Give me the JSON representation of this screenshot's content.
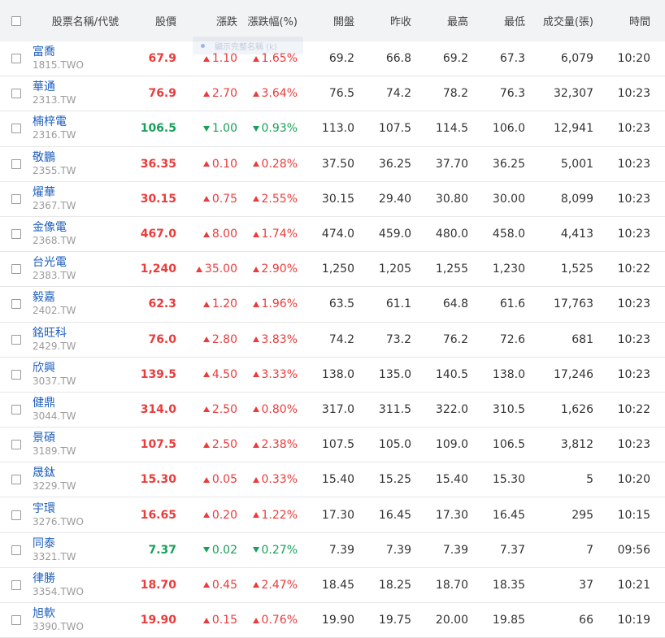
{
  "header": {
    "name_code": "股票名稱/代號",
    "price": "股價",
    "change": "漲跌",
    "change_pct": "漲跌幅(%)",
    "open": "開盤",
    "prev_close": "昨收",
    "high": "最高",
    "low": "最低",
    "volume": "成交量(張)",
    "time": "時間"
  },
  "tooltip": {
    "text": "顯示完整名稱 (k)"
  },
  "colors": {
    "up": "#eb3b3b",
    "down": "#18a058",
    "link": "#1f5fbf",
    "header_bg": "#f2f3f5"
  },
  "rows": [
    {
      "name": "富喬",
      "code": "1815.TWO",
      "price": "67.9",
      "change": "1.10",
      "pct": "1.65%",
      "open": "69.2",
      "prev": "66.8",
      "high": "69.2",
      "low": "67.3",
      "vol": "6,079",
      "time": "10:20",
      "dir": "up"
    },
    {
      "name": "華通",
      "code": "2313.TW",
      "price": "76.9",
      "change": "2.70",
      "pct": "3.64%",
      "open": "76.5",
      "prev": "74.2",
      "high": "78.2",
      "low": "76.3",
      "vol": "32,307",
      "time": "10:23",
      "dir": "up"
    },
    {
      "name": "楠梓電",
      "code": "2316.TW",
      "price": "106.5",
      "change": "1.00",
      "pct": "0.93%",
      "open": "113.0",
      "prev": "107.5",
      "high": "114.5",
      "low": "106.0",
      "vol": "12,941",
      "time": "10:23",
      "dir": "down"
    },
    {
      "name": "敬鵬",
      "code": "2355.TW",
      "price": "36.35",
      "change": "0.10",
      "pct": "0.28%",
      "open": "37.50",
      "prev": "36.25",
      "high": "37.70",
      "low": "36.25",
      "vol": "5,001",
      "time": "10:23",
      "dir": "up"
    },
    {
      "name": "燿華",
      "code": "2367.TW",
      "price": "30.15",
      "change": "0.75",
      "pct": "2.55%",
      "open": "30.15",
      "prev": "29.40",
      "high": "30.80",
      "low": "30.00",
      "vol": "8,099",
      "time": "10:23",
      "dir": "up"
    },
    {
      "name": "金像電",
      "code": "2368.TW",
      "price": "467.0",
      "change": "8.00",
      "pct": "1.74%",
      "open": "474.0",
      "prev": "459.0",
      "high": "480.0",
      "low": "458.0",
      "vol": "4,413",
      "time": "10:23",
      "dir": "up"
    },
    {
      "name": "台光電",
      "code": "2383.TW",
      "price": "1,240",
      "change": "35.00",
      "pct": "2.90%",
      "open": "1,250",
      "prev": "1,205",
      "high": "1,255",
      "low": "1,230",
      "vol": "1,525",
      "time": "10:22",
      "dir": "up"
    },
    {
      "name": "毅嘉",
      "code": "2402.TW",
      "price": "62.3",
      "change": "1.20",
      "pct": "1.96%",
      "open": "63.5",
      "prev": "61.1",
      "high": "64.8",
      "low": "61.6",
      "vol": "17,763",
      "time": "10:23",
      "dir": "up"
    },
    {
      "name": "銘旺科",
      "code": "2429.TW",
      "price": "76.0",
      "change": "2.80",
      "pct": "3.83%",
      "open": "74.2",
      "prev": "73.2",
      "high": "76.2",
      "low": "72.6",
      "vol": "681",
      "time": "10:23",
      "dir": "up"
    },
    {
      "name": "欣興",
      "code": "3037.TW",
      "price": "139.5",
      "change": "4.50",
      "pct": "3.33%",
      "open": "138.0",
      "prev": "135.0",
      "high": "140.5",
      "low": "138.0",
      "vol": "17,246",
      "time": "10:23",
      "dir": "up"
    },
    {
      "name": "健鼎",
      "code": "3044.TW",
      "price": "314.0",
      "change": "2.50",
      "pct": "0.80%",
      "open": "317.0",
      "prev": "311.5",
      "high": "322.0",
      "low": "310.5",
      "vol": "1,626",
      "time": "10:22",
      "dir": "up"
    },
    {
      "name": "景碩",
      "code": "3189.TW",
      "price": "107.5",
      "change": "2.50",
      "pct": "2.38%",
      "open": "107.5",
      "prev": "105.0",
      "high": "109.0",
      "low": "106.5",
      "vol": "3,812",
      "time": "10:23",
      "dir": "up"
    },
    {
      "name": "晟鈦",
      "code": "3229.TW",
      "price": "15.30",
      "change": "0.05",
      "pct": "0.33%",
      "open": "15.40",
      "prev": "15.25",
      "high": "15.40",
      "low": "15.30",
      "vol": "5",
      "time": "10:20",
      "dir": "up"
    },
    {
      "name": "宇環",
      "code": "3276.TWO",
      "price": "16.65",
      "change": "0.20",
      "pct": "1.22%",
      "open": "17.30",
      "prev": "16.45",
      "high": "17.30",
      "low": "16.45",
      "vol": "295",
      "time": "10:15",
      "dir": "up"
    },
    {
      "name": "同泰",
      "code": "3321.TW",
      "price": "7.37",
      "change": "0.02",
      "pct": "0.27%",
      "open": "7.39",
      "prev": "7.39",
      "high": "7.39",
      "low": "7.37",
      "vol": "7",
      "time": "09:56",
      "dir": "down"
    },
    {
      "name": "律勝",
      "code": "3354.TWO",
      "price": "18.70",
      "change": "0.45",
      "pct": "2.47%",
      "open": "18.45",
      "prev": "18.25",
      "high": "18.70",
      "low": "18.35",
      "vol": "37",
      "time": "10:21",
      "dir": "up"
    },
    {
      "name": "旭軟",
      "code": "3390.TWO",
      "price": "19.90",
      "change": "0.15",
      "pct": "0.76%",
      "open": "19.90",
      "prev": "19.75",
      "high": "20.00",
      "low": "19.85",
      "vol": "66",
      "time": "10:19",
      "dir": "up"
    }
  ]
}
